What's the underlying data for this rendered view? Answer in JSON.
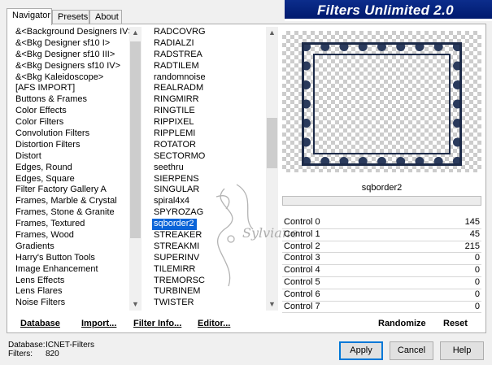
{
  "tabs": [
    "Navigator",
    "Presets",
    "About"
  ],
  "banner_title": "Filters Unlimited 2.0",
  "categories": [
    "&<Background Designers IV>",
    "&<Bkg Designer sf10 I>",
    "&<Bkg Designer sf10 III>",
    "&<Bkg Designers sf10 IV>",
    "&<Bkg Kaleidoscope>",
    "[AFS IMPORT]",
    "Buttons & Frames",
    "Color Effects",
    "Color Filters",
    "Convolution Filters",
    "Distortion Filters",
    "Distort",
    "Edges, Round",
    "Edges, Square",
    "Filter Factory Gallery A",
    "Frames, Marble & Crystal",
    "Frames, Stone & Granite",
    "Frames, Textured",
    "Frames, Wood",
    "Gradients",
    "Harry's Button Tools",
    "Image Enhancement",
    "Lens Effects",
    "Lens Flares",
    "Noise Filters"
  ],
  "filters": [
    "RADCOVRG",
    "RADIALZI",
    "RADSTREA",
    "RADTILEM",
    "randomnoise",
    "REALRADM",
    "RINGMIRR",
    "RINGTILE",
    "RIPPIXEL",
    "RIPPLEMI",
    "ROTATOR",
    "SECTORMO",
    "seethru",
    "SIERPENS",
    "SINGULAR",
    "spiral4x4",
    "SPYROZAG",
    "sqborder2",
    "STREAKER",
    "STREAKMI",
    "SUPERINV",
    "TILEMIRR",
    "TREMORSC",
    "TURBINEM",
    "TWISTER"
  ],
  "selected_filter_index": 17,
  "selected_filter_name": "sqborder2",
  "controls": [
    {
      "label": "Control 0",
      "value": "145"
    },
    {
      "label": "Control 1",
      "value": "45"
    },
    {
      "label": "Control 2",
      "value": "215"
    },
    {
      "label": "Control 3",
      "value": "0"
    },
    {
      "label": "Control 4",
      "value": "0"
    },
    {
      "label": "Control 5",
      "value": "0"
    },
    {
      "label": "Control 6",
      "value": "0"
    },
    {
      "label": "Control 7",
      "value": "0"
    }
  ],
  "links": {
    "database": "Database",
    "import": "Import...",
    "filter_info": "Filter Info...",
    "editor": "Editor...",
    "randomize": "Randomize",
    "reset": "Reset"
  },
  "footer": {
    "database_label": "Database:",
    "database_value": "ICNET-Filters",
    "filters_label": "Filters:",
    "filters_value": "820"
  },
  "buttons": {
    "apply": "Apply",
    "cancel": "Cancel",
    "help": "Help"
  },
  "watermark_text": "Sylviane",
  "colors": {
    "banner": "#0c2d8c",
    "selection": "#0a64d8",
    "default_button_border": "#0078d7"
  }
}
